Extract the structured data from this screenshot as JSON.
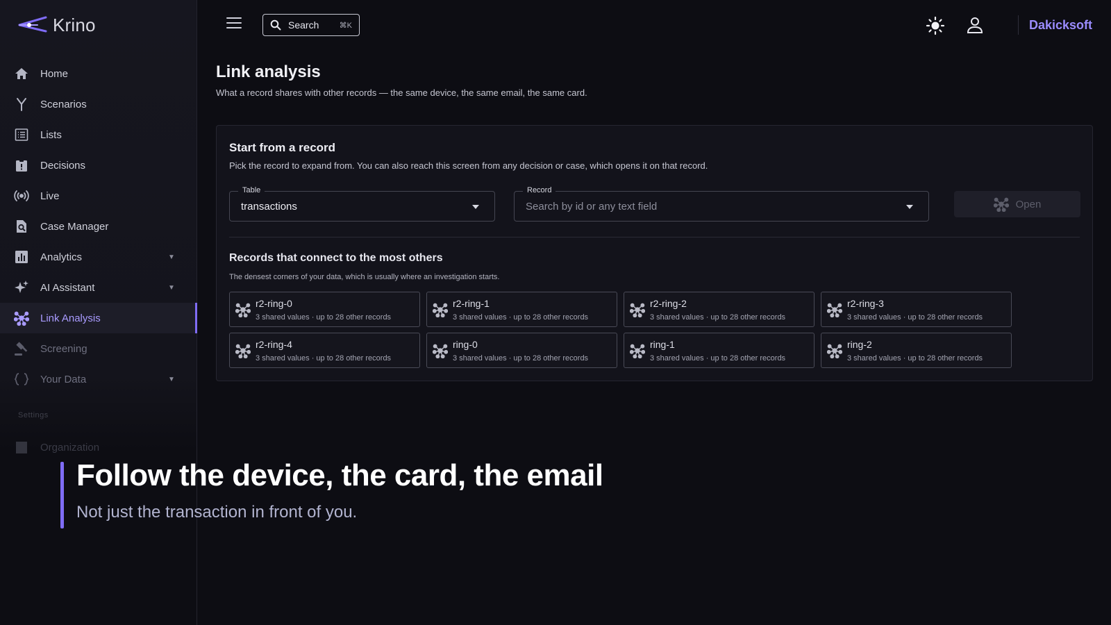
{
  "app": {
    "name": "Krino"
  },
  "sidebar": {
    "items": [
      {
        "label": "Home",
        "icon": "home-icon"
      },
      {
        "label": "Scenarios",
        "icon": "branch-icon"
      },
      {
        "label": "Lists",
        "icon": "list-icon"
      },
      {
        "label": "Decisions",
        "icon": "clipboard-icon"
      },
      {
        "label": "Live",
        "icon": "broadcast-icon"
      },
      {
        "label": "Case Manager",
        "icon": "case-search-icon"
      },
      {
        "label": "Analytics",
        "icon": "bar-chart-icon"
      },
      {
        "label": "AI Assistant",
        "icon": "sparkle-icon"
      },
      {
        "label": "Link Analysis",
        "icon": "network-icon"
      },
      {
        "label": "Screening",
        "icon": "gavel-icon"
      },
      {
        "label": "Your Data",
        "icon": "braces-icon"
      }
    ],
    "settings_label": "Settings",
    "organization_label": "Organization"
  },
  "topbar": {
    "search_label": "Search",
    "search_shortcut": "⌘K",
    "org_name": "Dakicksoft"
  },
  "page": {
    "title": "Link analysis",
    "subtitle": "What a record shares with other records — the same device, the same email, the same card."
  },
  "start_card": {
    "title": "Start from a record",
    "subtitle": "Pick the record to expand from. You can also reach this screen from any decision or case, which opens it on that record.",
    "table_label": "Table",
    "table_value": "transactions",
    "record_label": "Record",
    "record_placeholder": "Search by id or any text field",
    "open_label": "Open"
  },
  "top_records": {
    "title": "Records that connect to the most others",
    "subtitle": "The densest corners of your data, which is usually where an investigation starts.",
    "items": [
      {
        "name": "r2-ring-0",
        "meta": "3 shared values · up to 28 other records"
      },
      {
        "name": "r2-ring-1",
        "meta": "3 shared values · up to 28 other records"
      },
      {
        "name": "r2-ring-2",
        "meta": "3 shared values · up to 28 other records"
      },
      {
        "name": "r2-ring-3",
        "meta": "3 shared values · up to 28 other records"
      },
      {
        "name": "r2-ring-4",
        "meta": "3 shared values · up to 28 other records"
      },
      {
        "name": "ring-0",
        "meta": "3 shared values · up to 28 other records"
      },
      {
        "name": "ring-1",
        "meta": "3 shared values · up to 28 other records"
      },
      {
        "name": "ring-2",
        "meta": "3 shared values · up to 28 other records"
      }
    ]
  },
  "caption": {
    "title": "Follow the device, the card, the email",
    "subtitle": "Not just the transaction in front of you."
  },
  "colors": {
    "accent": "#7f6cf5",
    "accent_text": "#9b8cff",
    "background": "#0d0d13"
  }
}
